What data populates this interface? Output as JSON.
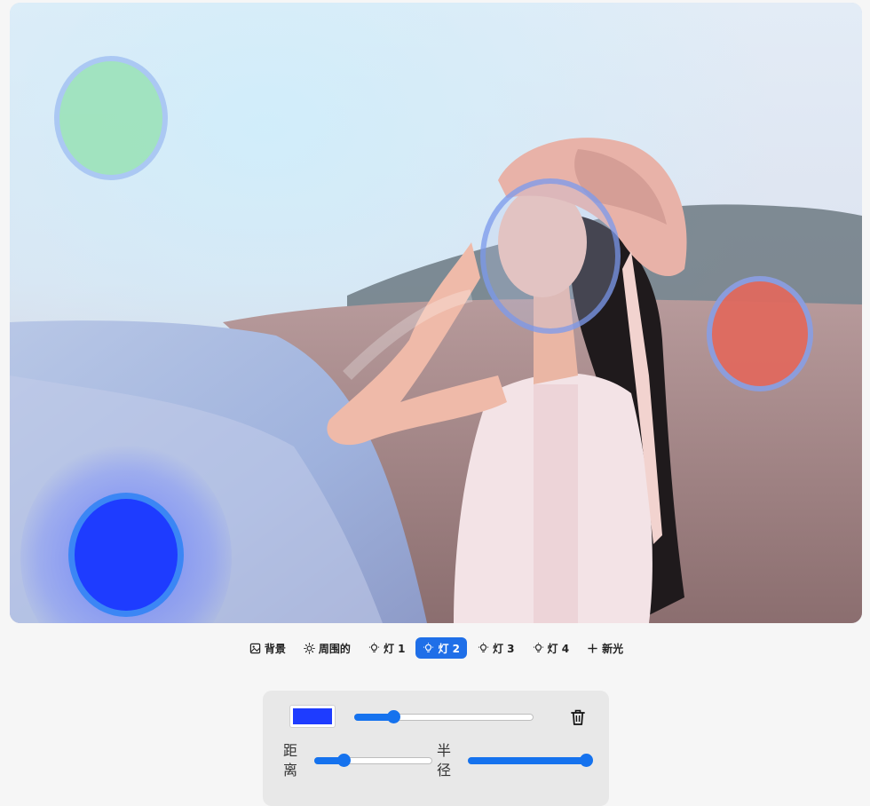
{
  "toolbar": {
    "items": [
      {
        "label": "背景",
        "icon": "image-icon",
        "active": false
      },
      {
        "label": "周围的",
        "icon": "sun-icon",
        "active": false
      },
      {
        "label": "灯 1",
        "icon": "bulb-icon",
        "active": false
      },
      {
        "label": "灯 2",
        "icon": "bulb-icon",
        "active": true
      },
      {
        "label": "灯 3",
        "icon": "bulb-icon",
        "active": false
      },
      {
        "label": "灯 4",
        "icon": "bulb-icon",
        "active": false
      },
      {
        "label": "新光",
        "icon": "plus-icon",
        "active": false
      }
    ]
  },
  "lights": [
    {
      "name": "light-1",
      "color": "#9fe3bd"
    },
    {
      "name": "light-2",
      "color": "#1e3cff"
    },
    {
      "name": "light-3",
      "color": "#e06a5f"
    },
    {
      "name": "light-4",
      "color": "#b8c8f0"
    }
  ],
  "panel": {
    "color": "#1e3cff",
    "intensity": 0.22,
    "distance_label": "距离",
    "distance": 0.25,
    "radius_label": "半径",
    "radius": 0.99
  },
  "colors": {
    "accent": "#1572ee",
    "active_tab": "#1f6fe8"
  }
}
